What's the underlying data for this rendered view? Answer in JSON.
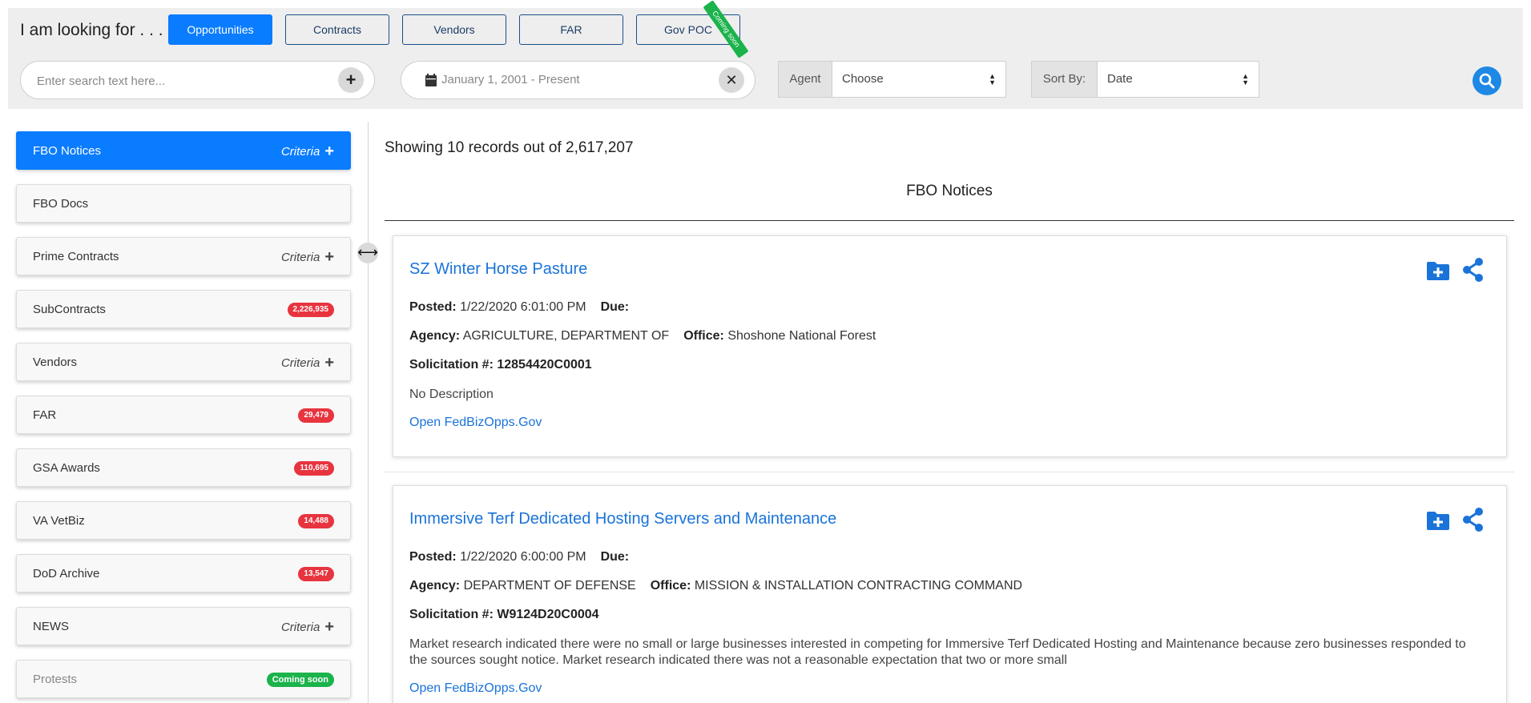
{
  "header": {
    "looking_for": "I am looking for . . .",
    "categories": [
      {
        "label": "Opportunities",
        "active": true
      },
      {
        "label": "Contracts",
        "active": false
      },
      {
        "label": "Vendors",
        "active": false
      },
      {
        "label": "FAR",
        "active": false
      },
      {
        "label": "Gov POC",
        "active": false,
        "ribbon": "Coming soon"
      }
    ],
    "search_placeholder": "Enter search text here...",
    "date_range": "January 1, 2001 - Present",
    "agent_label": "Agent",
    "agent_value": "Choose",
    "sort_label": "Sort By:",
    "sort_value": "Date",
    "accent_color": "#0a7cff"
  },
  "sidebar": {
    "items": [
      {
        "label": "FBO Notices",
        "criteria": "Criteria",
        "active": true
      },
      {
        "label": "FBO Docs"
      },
      {
        "label": "Prime Contracts",
        "criteria": "Criteria"
      },
      {
        "label": "SubContracts",
        "badge": "2,226,935"
      },
      {
        "label": "Vendors",
        "criteria": "Criteria"
      },
      {
        "label": "FAR",
        "badge": "29,479"
      },
      {
        "label": "GSA Awards",
        "badge": "110,695"
      },
      {
        "label": "VA VetBiz",
        "badge": "14,488"
      },
      {
        "label": "DoD Archive",
        "badge": "13,547"
      },
      {
        "label": "NEWS",
        "criteria": "Criteria"
      },
      {
        "label": "Protests",
        "badge": "Coming soon",
        "disabled": true
      }
    ]
  },
  "main": {
    "showing": "Showing 10 records out of 2,617,207",
    "section_title": "FBO Notices",
    "records": [
      {
        "title": "SZ Winter Horse Pasture",
        "posted_label": "Posted:",
        "posted": "1/22/2020 6:01:00 PM",
        "due_label": "Due:",
        "agency_label": "Agency:",
        "agency": "AGRICULTURE, DEPARTMENT OF",
        "office_label": "Office:",
        "office": "Shoshone National Forest",
        "solicitation_label": "Solicitation #:",
        "solicitation": "12854420C0001",
        "description": "No Description",
        "link": "Open FedBizOpps.Gov"
      },
      {
        "title": "Immersive Terf Dedicated Hosting Servers and Maintenance",
        "posted_label": "Posted:",
        "posted": "1/22/2020 6:00:00 PM",
        "due_label": "Due:",
        "agency_label": "Agency:",
        "agency": "DEPARTMENT OF DEFENSE",
        "office_label": "Office:",
        "office": "MISSION & INSTALLATION CONTRACTING COMMAND",
        "solicitation_label": "Solicitation #:",
        "solicitation": "W9124D20C0004",
        "description": "Market research indicated there were no small or large businesses interested in competing for Immersive Terf Dedicated Hosting and Maintenance because zero businesses responded to the sources sought notice.  Market research indicated there was not a reasonable expectation that two or more small",
        "link": "Open FedBizOpps.Gov"
      }
    ]
  }
}
